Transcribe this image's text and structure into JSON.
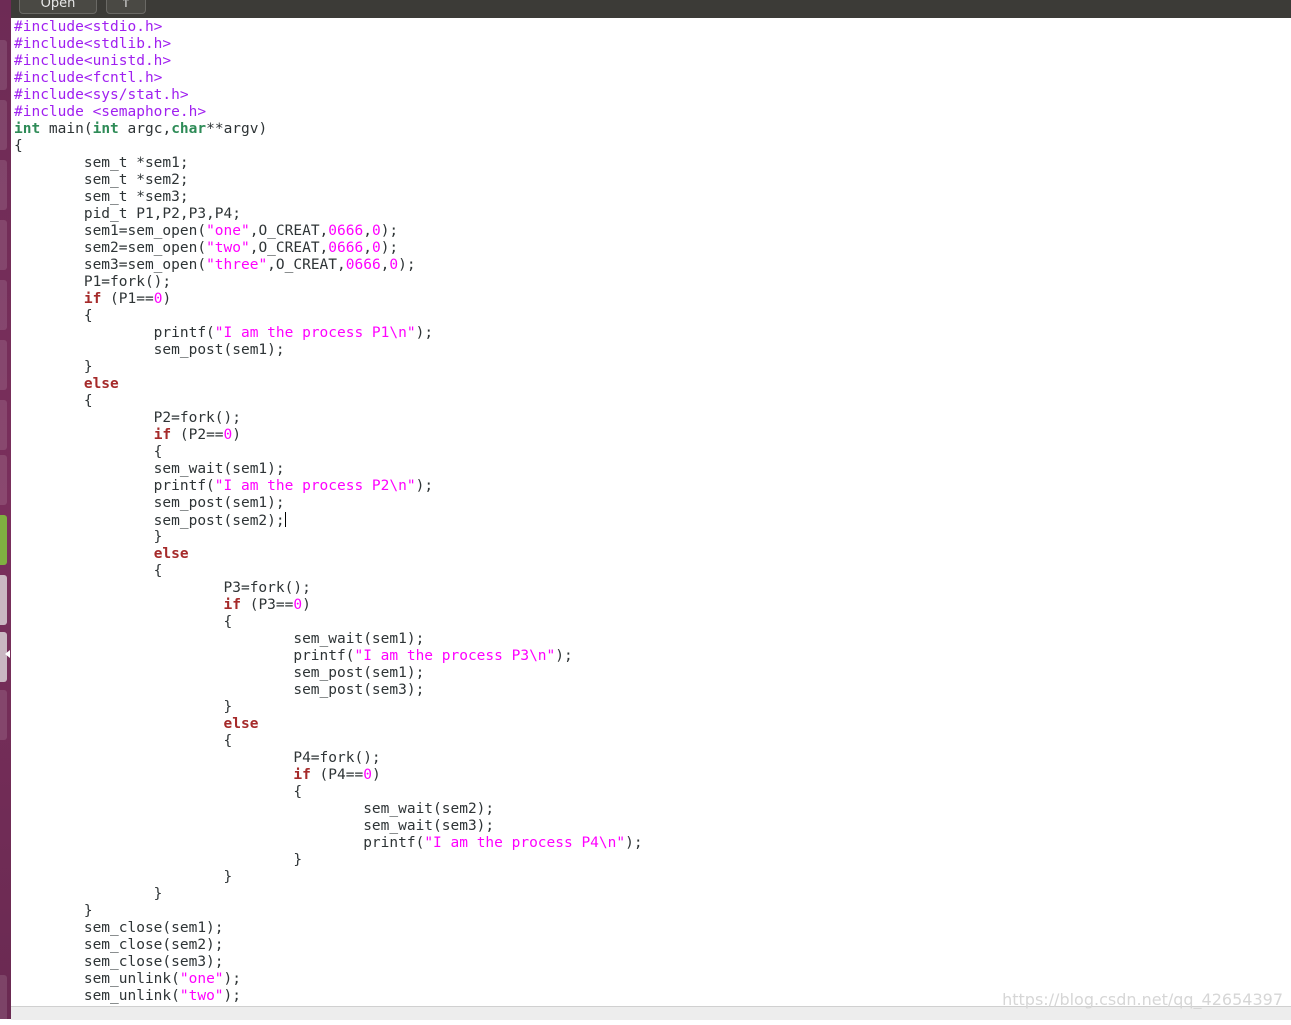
{
  "toolbar": {
    "open_label": "Open",
    "save_label": "↑"
  },
  "editor": {
    "lines": [
      [
        {
          "t": "#include<stdio.h>",
          "c": "pp"
        }
      ],
      [
        {
          "t": "#include<stdlib.h>",
          "c": "pp"
        }
      ],
      [
        {
          "t": "#include<unistd.h>",
          "c": "pp"
        }
      ],
      [
        {
          "t": "#include<fcntl.h>",
          "c": "pp"
        }
      ],
      [
        {
          "t": "#include<sys/stat.h>",
          "c": "pp"
        }
      ],
      [
        {
          "t": "#include <semaphore.h>",
          "c": "pp"
        }
      ],
      [
        {
          "t": "int",
          "c": "kw-type"
        },
        {
          "t": " main("
        },
        {
          "t": "int",
          "c": "kw-type"
        },
        {
          "t": " argc,"
        },
        {
          "t": "char",
          "c": "kw-type"
        },
        {
          "t": "**argv)"
        }
      ],
      [
        {
          "t": "{"
        }
      ],
      [
        {
          "t": "        sem_t *sem1;"
        }
      ],
      [
        {
          "t": "        sem_t *sem2;"
        }
      ],
      [
        {
          "t": "        sem_t *sem3;"
        }
      ],
      [
        {
          "t": "        pid_t P1,P2,P3,P4;"
        }
      ],
      [
        {
          "t": "        sem1=sem_open("
        },
        {
          "t": "\"one\"",
          "c": "str"
        },
        {
          "t": ",O_CREAT,"
        },
        {
          "t": "0666",
          "c": "num"
        },
        {
          "t": ","
        },
        {
          "t": "0",
          "c": "num"
        },
        {
          "t": ");"
        }
      ],
      [
        {
          "t": "        sem2=sem_open("
        },
        {
          "t": "\"two\"",
          "c": "str"
        },
        {
          "t": ",O_CREAT,"
        },
        {
          "t": "0666",
          "c": "num"
        },
        {
          "t": ","
        },
        {
          "t": "0",
          "c": "num"
        },
        {
          "t": ");"
        }
      ],
      [
        {
          "t": "        sem3=sem_open("
        },
        {
          "t": "\"three\"",
          "c": "str"
        },
        {
          "t": ",O_CREAT,"
        },
        {
          "t": "0666",
          "c": "num"
        },
        {
          "t": ","
        },
        {
          "t": "0",
          "c": "num"
        },
        {
          "t": ");"
        }
      ],
      [
        {
          "t": "        P1=fork();"
        }
      ],
      [
        {
          "t": "        "
        },
        {
          "t": "if",
          "c": "kw"
        },
        {
          "t": " (P1=="
        },
        {
          "t": "0",
          "c": "num"
        },
        {
          "t": ")"
        }
      ],
      [
        {
          "t": "        {"
        }
      ],
      [
        {
          "t": "                printf("
        },
        {
          "t": "\"I am the process P1\\n\"",
          "c": "str"
        },
        {
          "t": ");"
        }
      ],
      [
        {
          "t": "                sem_post(sem1);"
        }
      ],
      [
        {
          "t": "        }"
        }
      ],
      [
        {
          "t": "        "
        },
        {
          "t": "else",
          "c": "kw"
        }
      ],
      [
        {
          "t": "        {"
        }
      ],
      [
        {
          "t": "                P2=fork();"
        }
      ],
      [
        {
          "t": "                "
        },
        {
          "t": "if",
          "c": "kw"
        },
        {
          "t": " (P2=="
        },
        {
          "t": "0",
          "c": "num"
        },
        {
          "t": ")"
        }
      ],
      [
        {
          "t": "                {"
        }
      ],
      [
        {
          "t": "                sem_wait(sem1);"
        }
      ],
      [
        {
          "t": "                printf("
        },
        {
          "t": "\"I am the process P2\\n\"",
          "c": "str"
        },
        {
          "t": ");"
        }
      ],
      [
        {
          "t": "                sem_post(sem1);"
        }
      ],
      [
        {
          "t": "                sem_post(sem2);"
        },
        {
          "caret": true
        }
      ],
      [
        {
          "t": "                }"
        }
      ],
      [
        {
          "t": "                "
        },
        {
          "t": "else",
          "c": "kw"
        }
      ],
      [
        {
          "t": "                {"
        }
      ],
      [
        {
          "t": "                        P3=fork();"
        }
      ],
      [
        {
          "t": "                        "
        },
        {
          "t": "if",
          "c": "kw"
        },
        {
          "t": " (P3=="
        },
        {
          "t": "0",
          "c": "num"
        },
        {
          "t": ")"
        }
      ],
      [
        {
          "t": "                        {"
        }
      ],
      [
        {
          "t": "                                sem_wait(sem1);"
        }
      ],
      [
        {
          "t": "                                printf("
        },
        {
          "t": "\"I am the process P3\\n\"",
          "c": "str"
        },
        {
          "t": ");"
        }
      ],
      [
        {
          "t": "                                sem_post(sem1);"
        }
      ],
      [
        {
          "t": "                                sem_post(sem3);"
        }
      ],
      [
        {
          "t": "                        }"
        }
      ],
      [
        {
          "t": "                        "
        },
        {
          "t": "else",
          "c": "kw"
        }
      ],
      [
        {
          "t": "                        {"
        }
      ],
      [
        {
          "t": "                                P4=fork();"
        }
      ],
      [
        {
          "t": "                                "
        },
        {
          "t": "if",
          "c": "kw"
        },
        {
          "t": " (P4=="
        },
        {
          "t": "0",
          "c": "num"
        },
        {
          "t": ")"
        }
      ],
      [
        {
          "t": "                                {"
        }
      ],
      [
        {
          "t": "                                        sem_wait(sem2);"
        }
      ],
      [
        {
          "t": "                                        sem_wait(sem3);"
        }
      ],
      [
        {
          "t": "                                        printf("
        },
        {
          "t": "\"I am the process P4\\n\"",
          "c": "str"
        },
        {
          "t": ");"
        }
      ],
      [
        {
          "t": "                                }"
        }
      ],
      [
        {
          "t": "                        }"
        }
      ],
      [
        {
          "t": "                }"
        }
      ],
      [
        {
          "t": "        }"
        }
      ],
      [
        {
          "t": "        sem_close(sem1);"
        }
      ],
      [
        {
          "t": "        sem_close(sem2);"
        }
      ],
      [
        {
          "t": "        sem_close(sem3);"
        }
      ],
      [
        {
          "t": "        sem_unlink("
        },
        {
          "t": "\"one\"",
          "c": "str"
        },
        {
          "t": ");"
        }
      ],
      [
        {
          "t": "        sem_unlink("
        },
        {
          "t": "\"two\"",
          "c": "str"
        },
        {
          "t": ");"
        }
      ]
    ]
  },
  "watermark": "https://blog.csdn.net/qq_42654397",
  "colors": {
    "preprocessor": "#a020f0",
    "type_keyword": "#2e8b57",
    "control_keyword": "#a52a2a",
    "string_literal": "#ff00ff",
    "number_literal": "#ff00ff",
    "launcher_bg": "#7a2f5c",
    "toolbar_bg": "#3c3b37"
  }
}
